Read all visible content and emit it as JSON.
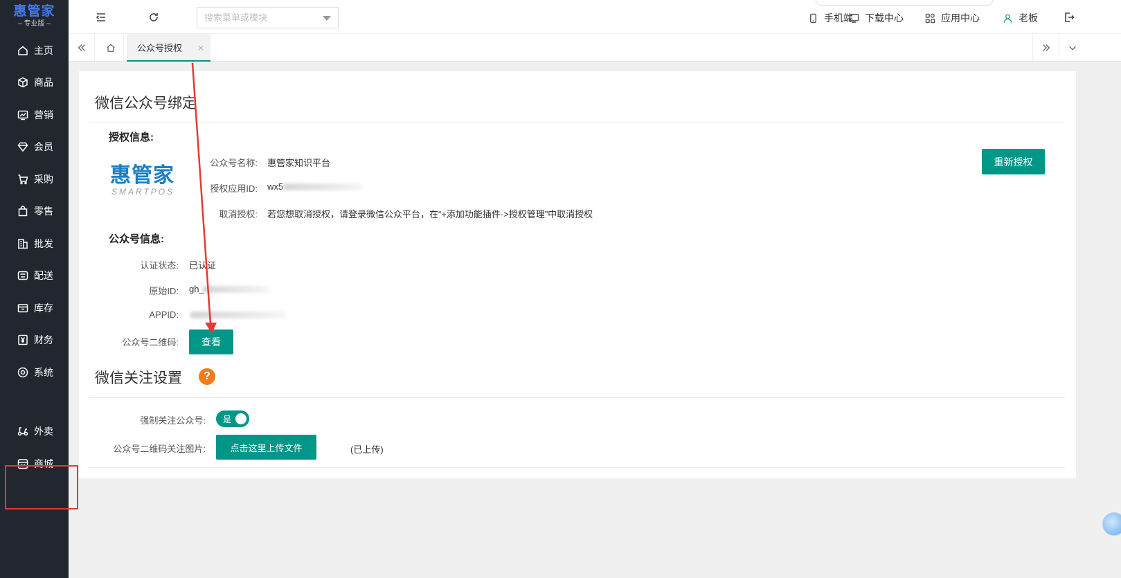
{
  "sidebar": {
    "logo_main": "惠管家",
    "logo_sub": "– 专业版 –",
    "items": [
      {
        "label": "主页",
        "icon": "home-icon"
      },
      {
        "label": "商品",
        "icon": "box-icon"
      },
      {
        "label": "营销",
        "icon": "chart-icon"
      },
      {
        "label": "会员",
        "icon": "diamond-icon"
      },
      {
        "label": "采购",
        "icon": "cart-icon"
      },
      {
        "label": "零售",
        "icon": "bag-icon"
      },
      {
        "label": "批发",
        "icon": "building-icon"
      },
      {
        "label": "配送",
        "icon": "truck-icon"
      },
      {
        "label": "库存",
        "icon": "warehouse-icon"
      },
      {
        "label": "财务",
        "icon": "yen-icon"
      },
      {
        "label": "系统",
        "icon": "gear-icon"
      },
      {
        "label": "外卖",
        "icon": "scooter-icon"
      },
      {
        "label": "商城",
        "icon": "store-icon"
      }
    ]
  },
  "topbar": {
    "search_placeholder": "搜索菜单或模块",
    "links": {
      "mobile": "手机端",
      "download": "下载中心",
      "apps": "应用中心",
      "user": "老板"
    }
  },
  "tabs": {
    "active": "公众号授权",
    "close": "×"
  },
  "binding": {
    "title": "微信公众号绑定",
    "auth_info_title": "授权信息:",
    "brand_logo_text": "惠管家",
    "brand_logo_sub": "SMARTPOS",
    "account_name_label": "公众号名称:",
    "account_name": "惠管家知识平台",
    "auth_app_id_label": "授权应用ID:",
    "auth_app_id_prefix": "wx5",
    "cancel_label": "取消授权:",
    "cancel_text": "若您想取消授权，请登录微信公众平台，在“+添加功能插件->授权管理”中取消授权",
    "reauth_button": "重新授权",
    "account_info_title": "公众号信息:",
    "verify_label": "认证状态:",
    "verify_value": "已认证",
    "original_id_label": "原始ID:",
    "original_id_prefix": "gh_",
    "appid_label": "APPID:",
    "qrcode_label": "公众号二维码:",
    "view_button": "查看"
  },
  "follow": {
    "title": "微信关注设置",
    "force_follow_label": "强制关注公众号:",
    "toggle_text": "是",
    "toggle_on": true,
    "qr_image_label": "公众号二维码关注图片:",
    "upload_button": "点击这里上传文件",
    "upload_status": "(已上传)"
  },
  "colors": {
    "primary": "#009688",
    "sidebar_bg": "#22262e",
    "annotation_red": "#e53935",
    "help_orange": "#f07c1d"
  }
}
